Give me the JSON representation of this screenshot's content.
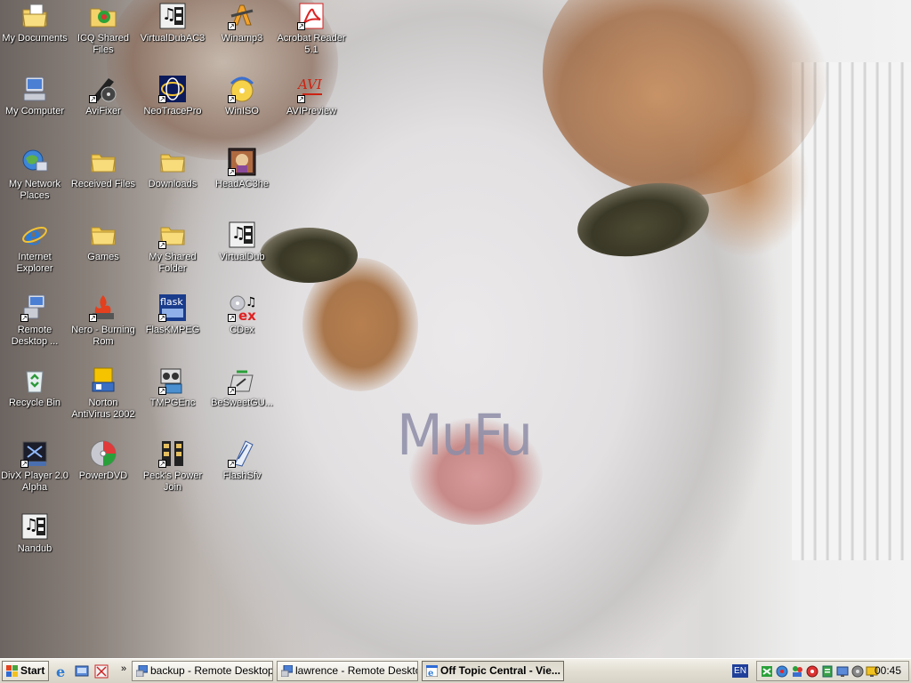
{
  "wallpaper": {
    "watermark": "MuFu"
  },
  "icons": [
    {
      "label": "My Documents",
      "glyph": "my-documents-icon"
    },
    {
      "label": "ICQ Shared Files",
      "glyph": "icq-shared-files-icon"
    },
    {
      "label": "VirtualDubAC3",
      "glyph": "virtualdubac3-icon"
    },
    {
      "label": "Winamp3",
      "glyph": "winamp3-icon"
    },
    {
      "label": "Acrobat Reader 5.1",
      "glyph": "acrobat-reader-icon"
    },
    {
      "label": "My Computer",
      "glyph": "my-computer-icon"
    },
    {
      "label": "AviFixer",
      "glyph": "avifixer-icon"
    },
    {
      "label": "NeoTracePro",
      "glyph": "neotracepro-icon"
    },
    {
      "label": "WinISO",
      "glyph": "winiso-icon"
    },
    {
      "label": "AVIPreview",
      "glyph": "avipreview-icon",
      "glyph_text": "AVI"
    },
    {
      "label": "My Network Places",
      "glyph": "network-places-icon"
    },
    {
      "label": "Received Files",
      "glyph": "folder-icon"
    },
    {
      "label": "Downloads",
      "glyph": "folder-icon"
    },
    {
      "label": "HeadAC3he",
      "glyph": "headac3he-icon"
    },
    {
      "label": "Internet Explorer",
      "glyph": "internet-explorer-icon"
    },
    {
      "label": "Games",
      "glyph": "folder-icon"
    },
    {
      "label": "My Shared Folder",
      "glyph": "folder-icon"
    },
    {
      "label": "VirtualDub",
      "glyph": "virtualdub-icon"
    },
    {
      "label": "Remote Desktop ...",
      "glyph": "remote-desktop-icon"
    },
    {
      "label": "Nero - Burning Rom",
      "glyph": "nero-icon"
    },
    {
      "label": "FlasKMPEG",
      "glyph": "flaskmpeg-icon",
      "glyph_text": "flask"
    },
    {
      "label": "CDex",
      "glyph": "cdex-icon",
      "glyph_text": "ex"
    },
    {
      "label": "Recycle Bin",
      "glyph": "recycle-bin-icon"
    },
    {
      "label": "Norton AntiVirus 2002",
      "glyph": "norton-antivirus-icon"
    },
    {
      "label": "TMPGEnc",
      "glyph": "tmpgenc-icon"
    },
    {
      "label": "BeSweetGU...",
      "glyph": "besweet-icon"
    },
    {
      "label": "DivX Player 2.0 Alpha",
      "glyph": "divx-player-icon"
    },
    {
      "label": "PowerDVD",
      "glyph": "powerdvd-icon"
    },
    {
      "label": "Peck's Power Join",
      "glyph": "pecks-power-join-icon"
    },
    {
      "label": "FlashSfv",
      "glyph": "flashsfv-icon"
    },
    {
      "label": "Nandub",
      "glyph": "nandub-icon"
    }
  ],
  "taskbar": {
    "start_label": "Start",
    "tasks": [
      {
        "label": "backup - Remote Desktop"
      },
      {
        "label": "lawrence - Remote Desktop"
      },
      {
        "label": "Off Topic Central - Vie..."
      }
    ],
    "language": "EN",
    "clock": "00:45"
  }
}
